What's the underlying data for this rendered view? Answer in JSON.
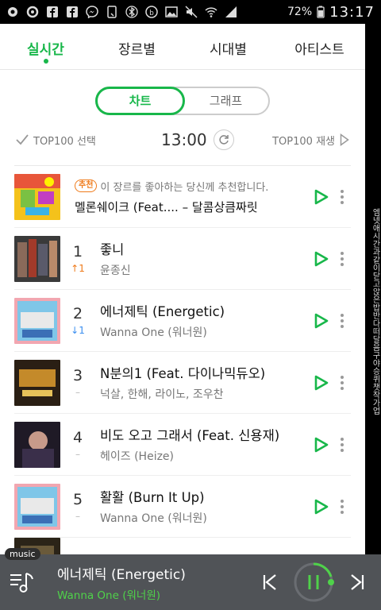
{
  "status": {
    "battery": "72%",
    "time": "13:17",
    "icons": [
      "notification-icon",
      "settings-icon",
      "facebook-icon",
      "facebook-icon",
      "messenger-icon",
      "tablet-icon",
      "bluetooth-icon",
      "bixby-icon",
      "gallery-icon",
      "mute-icon",
      "wifi-icon",
      "signal-icon"
    ]
  },
  "tabs": [
    "실시간",
    "장르별",
    "시대별",
    "아티스트"
  ],
  "segment": {
    "chart": "차트",
    "graph": "그래프"
  },
  "controls": {
    "select_label": "TOP100 선택",
    "time": "13:00",
    "play_label": "TOP100 재생"
  },
  "recommendation": {
    "badge": "추천",
    "message": "이 장르를 좋아하는 당신께 추천합니다.",
    "song": "멜론쉐이크 (Feat.... – 달콤상큼짜릿"
  },
  "songs": [
    {
      "rank": "1",
      "delta": "↑1",
      "delta_type": "up",
      "title": "좋니",
      "artist": "윤종신"
    },
    {
      "rank": "2",
      "delta": "↓1",
      "delta_type": "down",
      "title": "에너제틱 (Energetic)",
      "artist": "Wanna One (워너원)"
    },
    {
      "rank": "3",
      "delta": "–",
      "delta_type": "same",
      "title": "N분의1 (Feat. 다이나믹듀오)",
      "artist": "넉살, 한해, 라이노, 조우찬"
    },
    {
      "rank": "4",
      "delta": "–",
      "delta_type": "same",
      "title": "비도 오고 그래서 (Feat. 신용재)",
      "artist": "헤이즈 (Heize)"
    },
    {
      "rank": "5",
      "delta": "–",
      "delta_type": "same",
      "title": "활활 (Burn It Up)",
      "artist": "Wanna One (워너원)"
    }
  ],
  "side_text": "엠넷애시간과같이닫고앉은밥반다떠달음구야승퀴챗작가업",
  "player": {
    "tag": "music",
    "title": "에너제틱 (Energetic)",
    "artist": "Wanna One (워너원)"
  },
  "colors": {
    "accent": "#18b74a",
    "player_bg": "#505357",
    "up": "#ef7a1a",
    "down": "#3b8ff0"
  }
}
